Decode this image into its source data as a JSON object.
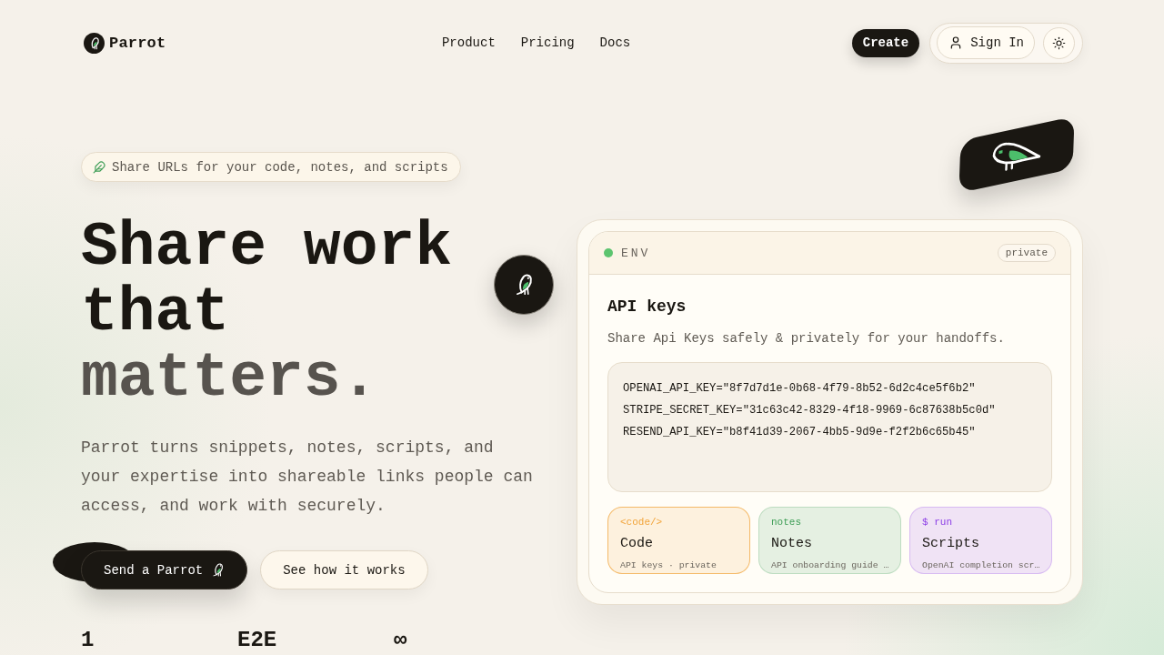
{
  "nav": {
    "brand": "Parrot",
    "links": [
      "Product",
      "Pricing",
      "Docs"
    ],
    "create_button": "Create",
    "sign_in_button": "Sign In"
  },
  "hero": {
    "badge": "Share URLs for your code, notes, and scripts",
    "heading_lines": [
      {
        "text": "Share work",
        "muted": false
      },
      {
        "text": "that",
        "muted": false
      },
      {
        "text": "matters.",
        "muted": true
      }
    ],
    "description": "Parrot turns snippets, notes, scripts, and your expertise into shareable links people can access, and work with securely.",
    "buttons": [
      {
        "label": "Send a Parrot",
        "kind": "primary"
      },
      {
        "label": "See how it works",
        "kind": "secondary"
      }
    ],
    "stats": [
      "1",
      "E2E",
      "∞"
    ]
  },
  "preview": {
    "header": {
      "label": "ENV",
      "badge": "private"
    },
    "title": "API keys",
    "subtitle": "Share Api Keys safely & privately for your handoffs.",
    "code_lines": [
      "OPENAI_API_KEY=\"8f7d7d1e-0b68-4f79-8b52-6d2c4ce5f6b2\"",
      "STRIPE_SECRET_KEY=\"31c63c42-8329-4f18-9969-6c87638b5c0d\"",
      "RESEND_API_KEY=\"b8f41d39-2067-4bb5-9d9e-f2f2b6c65b45\""
    ],
    "cards": [
      {
        "tag": "<code/>",
        "title": "Code",
        "description": "API keys · private",
        "color": "#f2a53c",
        "selected": true
      },
      {
        "tag": "notes",
        "title": "Notes",
        "description": "API onboarding guide …",
        "color": "#3f9e57",
        "selected": false
      },
      {
        "tag": "$ run",
        "title": "Scripts",
        "description": "OpenAI completion scr…",
        "color": "#8b3de6",
        "selected": false
      }
    ]
  }
}
